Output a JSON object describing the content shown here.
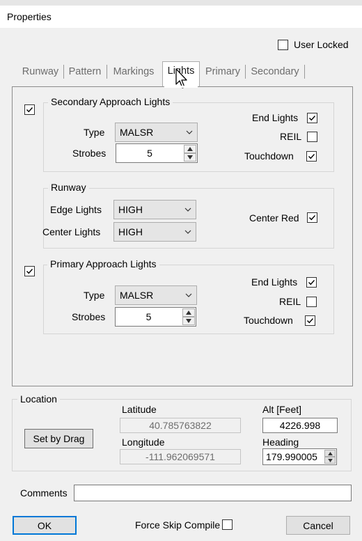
{
  "window": {
    "title": "Properties"
  },
  "user_locked": {
    "label": "User Locked",
    "checked": false
  },
  "tabs": [
    {
      "label": "Runway",
      "active": false
    },
    {
      "label": "Pattern",
      "active": false
    },
    {
      "label": "Markings",
      "active": false
    },
    {
      "label": "Lights",
      "active": true
    },
    {
      "label": "Primary",
      "active": false
    },
    {
      "label": "Secondary",
      "active": false
    }
  ],
  "secondary_approach": {
    "enabled": true,
    "title": "Secondary Approach Lights",
    "type_label": "Type",
    "type_value": "MALSR",
    "strobes_label": "Strobes",
    "strobes_value": "5",
    "end_lights_label": "End Lights",
    "end_lights": true,
    "reil_label": "REIL",
    "reil": false,
    "touchdown_label": "Touchdown",
    "touchdown": true
  },
  "runway_group": {
    "title": "Runway",
    "edge_lights_label": "Edge Lights",
    "edge_lights_value": "HIGH",
    "center_lights_label": "Center Lights",
    "center_lights_value": "HIGH",
    "center_red_label": "Center Red",
    "center_red": true
  },
  "primary_approach": {
    "enabled": true,
    "title": "Primary Approach Lights",
    "type_label": "Type",
    "type_value": "MALSR",
    "strobes_label": "Strobes",
    "strobes_value": "5",
    "end_lights_label": "End Lights",
    "end_lights": true,
    "reil_label": "REIL",
    "reil": false,
    "touchdown_label": "Touchdown",
    "touchdown": true
  },
  "location": {
    "title": "Location",
    "set_by_drag_label": "Set by Drag",
    "latitude_label": "Latitude",
    "latitude_value": "40.785763822",
    "longitude_label": "Longitude",
    "longitude_value": "-111.962069571",
    "alt_label": "Alt [Feet]",
    "alt_value": "4226.998",
    "heading_label": "Heading",
    "heading_value": "179.990005"
  },
  "comments": {
    "label": "Comments",
    "value": ""
  },
  "footer": {
    "ok_label": "OK",
    "force_skip_label": "Force Skip Compile",
    "force_skip": false,
    "cancel_label": "Cancel"
  }
}
